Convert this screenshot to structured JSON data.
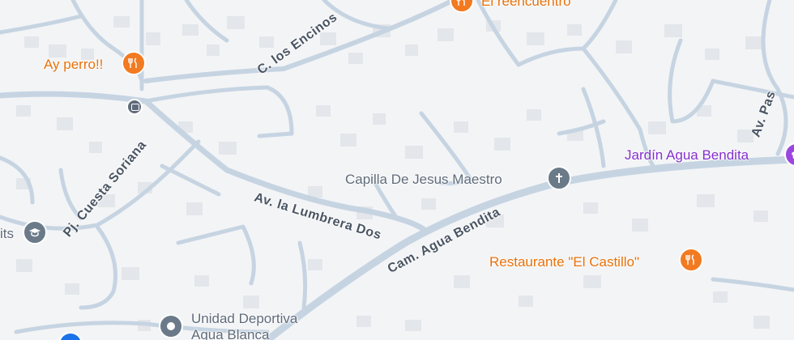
{
  "map": {
    "colors": {
      "background": "#f3f4f6",
      "road": "#c6d4e2",
      "building": "#e3e6ea",
      "poi_restaurant": "#e8710a",
      "poi_place": "#5f6b7a",
      "poi_garden": "#8430ce"
    },
    "streets": {
      "los_encinos": "C. los Encinos",
      "lumbrera_dos": "Av. la Lumbrera Dos",
      "cuesta_soriana": "Pj. Cuesta Soriana",
      "agua_bendita": "Cam. Agua Bendita",
      "av_pas_partial": "Av. Pas"
    },
    "pois": {
      "el_reencuentro": "El reencuentro",
      "ay_perro": "Ay perro!!",
      "capilla": "Capilla De Jesus Maestro",
      "jardin": "Jardín Agua Bendita",
      "restaurante": "Restaurante \"El Castillo\"",
      "unidad_line1": "Unidad Deportiva",
      "unidad_line2": "Agua Blanca",
      "its_partial": "its"
    },
    "icons": {
      "restaurant": "fork-knife-icon",
      "bus": "bus-stop-icon",
      "church": "cross-icon",
      "school": "graduation-cap-icon",
      "place": "place-marker-icon",
      "garden": "garden-icon"
    }
  }
}
